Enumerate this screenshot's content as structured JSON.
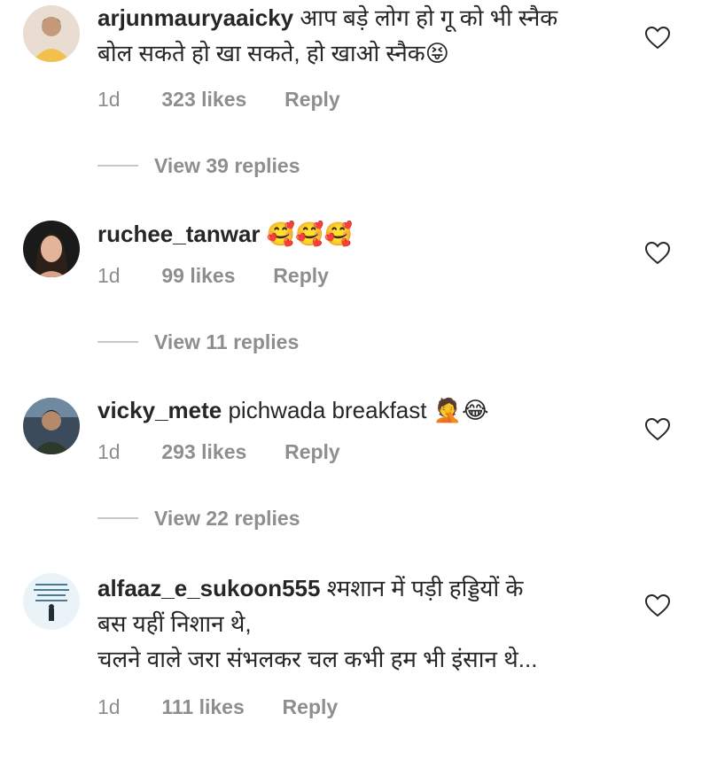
{
  "comments": [
    {
      "username": "arjunmauryaaicky",
      "text_line1": "आप बड़े लोग हो गू को भी स्नैक",
      "text_line2": "बोल सकते हो खा सकते, हो खाओ स्नैक😝",
      "time": "1d",
      "likes": "323 likes",
      "reply": "Reply",
      "view_replies": "View 39 replies"
    },
    {
      "username": "ruchee_tanwar",
      "text_line1": "🥰🥰🥰",
      "time": "1d",
      "likes": "99 likes",
      "reply": "Reply",
      "view_replies": "View 11 replies"
    },
    {
      "username": "vicky_mete",
      "text_line1": "pichwada breakfast 🤦😂",
      "time": "1d",
      "likes": "293 likes",
      "reply": "Reply",
      "view_replies": "View 22 replies"
    },
    {
      "username": "alfaaz_e_sukoon555",
      "text_line1": "श्मशान में पड़ी हड्डियों के",
      "text_line2": "बस यहीं निशान थे,",
      "text_line3": "चलने वाले जरा संभलकर चल कभी हम भी इंसान थे...",
      "time": "1d",
      "likes": "111 likes",
      "reply": "Reply"
    }
  ],
  "icons": {
    "like": "heart-outline-icon"
  },
  "colors": {
    "text": "#262626",
    "secondary": "#8e8e8e",
    "divider": "#c7c7c7"
  }
}
